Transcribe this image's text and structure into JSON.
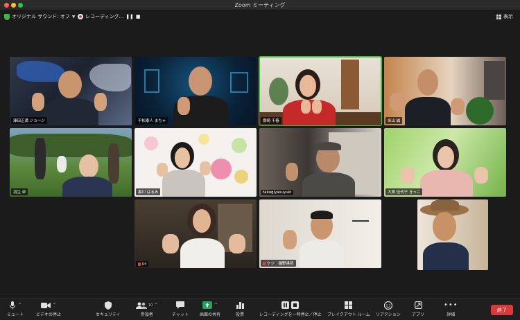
{
  "window": {
    "title": "Zoom ミーティング"
  },
  "infobar": {
    "audio_label": "オリジナル サウンド: オフ",
    "recording_label": "レコーディング...",
    "view_label": "表示"
  },
  "participants": [
    {
      "name": "澤田正満 ジョージ"
    },
    {
      "name": "平松泰人 まちゃ"
    },
    {
      "name": "齋崎 千春"
    },
    {
      "name": "米山 誠"
    },
    {
      "name": "羽生 卓"
    },
    {
      "name": "黒川 はるみ"
    },
    {
      "name": "takagiyasuyuki"
    },
    {
      "name": "大美 佳代子 きっこ"
    },
    {
      "name": "ps"
    },
    {
      "name": "ケツ　磯野達弥"
    },
    {
      "name": ""
    }
  ],
  "toolbar": {
    "mute": "ミュート",
    "video_stop": "ビデオの停止",
    "security": "セキュリティ",
    "participants": "参加者",
    "participants_count": "10",
    "chat": "チャット",
    "share": "画面の共有",
    "vote": "投票",
    "recording_pause": "レコーディングを一時停止／停止",
    "breakout": "ブレイクアウト ルーム",
    "reaction": "リアクション",
    "apps": "アプリ",
    "details": "詳細",
    "end": "終了"
  },
  "colors": {
    "accent_green": "#3ec23a",
    "end_red": "#d9393b",
    "rec_red": "#e5403a",
    "share_green": "#23a559"
  }
}
